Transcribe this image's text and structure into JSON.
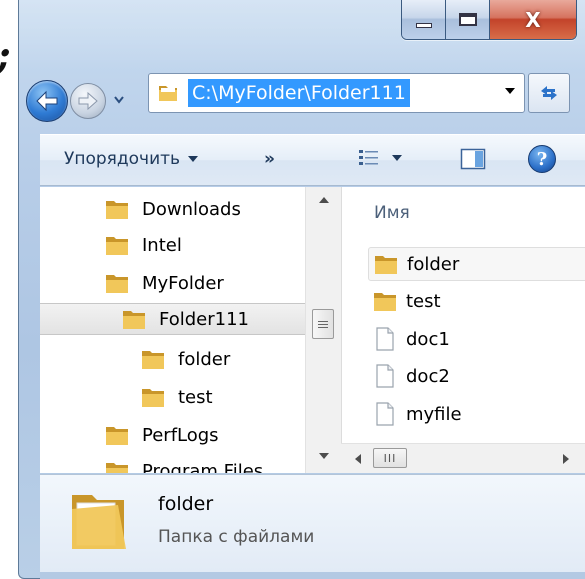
{
  "background": {
    "glyph": ";"
  },
  "window": {
    "controls": {
      "close_label": "X"
    }
  },
  "address_bar": {
    "path": "C:\\MyFolder\\Folder111"
  },
  "toolbar": {
    "organize_label": "Упорядочить",
    "more_label": "»",
    "help_label": "?"
  },
  "nav_tree": {
    "items": [
      {
        "label": "Downloads",
        "level": 1
      },
      {
        "label": "Intel",
        "level": 1
      },
      {
        "label": "MyFolder",
        "level": 1
      },
      {
        "label": "Folder111",
        "level": 2,
        "selected": true
      },
      {
        "label": "folder",
        "level": 3
      },
      {
        "label": "test",
        "level": 3
      },
      {
        "label": "PerfLogs",
        "level": 1
      },
      {
        "label": "Program Files",
        "level": 1
      }
    ]
  },
  "hscroll": {
    "thumb_label": "III"
  },
  "content": {
    "column_header": "Имя",
    "items": [
      {
        "label": "folder",
        "type": "folder",
        "hover": true
      },
      {
        "label": "test",
        "type": "folder"
      },
      {
        "label": "doc1",
        "type": "file"
      },
      {
        "label": "doc2",
        "type": "file"
      },
      {
        "label": "myfile",
        "type": "file"
      }
    ]
  },
  "details": {
    "name": "folder",
    "type": "Папка с файлами"
  },
  "colors": {
    "selection": "#3399ff",
    "folder": "#f1c75a",
    "folder_dark": "#c9962a",
    "frame": "#b7cde8",
    "close_button": "#c3432a"
  }
}
